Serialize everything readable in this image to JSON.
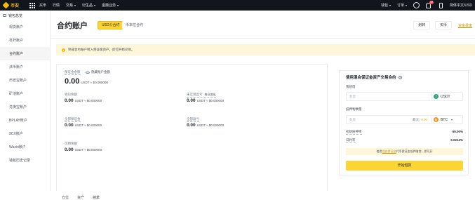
{
  "topbar": {
    "logo_text": "币安",
    "nav": [
      "买币",
      "行情",
      "交易",
      "衍生品",
      "金融业务"
    ],
    "nav_carets": [
      false,
      false,
      true,
      true,
      true
    ],
    "right": {
      "wallet": "钱包",
      "orders": "订单",
      "notifications_count": "18",
      "language": "简体中文/USD"
    }
  },
  "sidebar": {
    "header": "钱包总览",
    "items": [
      "现货账户",
      "杠杆账户",
      "合约账户",
      "法币账户",
      "币安宝账户",
      "矿池账户",
      "兑换宝账户",
      "BPLAY账户",
      "3CX账户",
      "Waziri账户",
      "钱包历史记录"
    ],
    "active_index": 2
  },
  "header": {
    "title": "合约账户",
    "tabs": [
      "USDⓈ合约",
      "币本位合约"
    ],
    "active_tab": 0,
    "buttons": [
      "划转",
      "买币"
    ],
    "link": "资金费率"
  },
  "notice": {
    "icon": "i",
    "text": "完成合约账户转入保证金资产，即可开始交易。"
  },
  "account": {
    "margin_balance_label": "保证金余额",
    "hide_balance_label": "隐藏账户金额",
    "margin_balance": "0.00",
    "margin_balance_fiat": "USDT ≈ $0.000000",
    "wallet_balance_label": "钱包余额",
    "wallet_balance": "0.00",
    "wallet_balance_fiat": "USDT ≈ $0.000000",
    "unrealized_label": "未实现盈亏",
    "unrealized_sort": "每日变化",
    "unrealized": "0.00",
    "unrealized_fiat": "USDT ≈ $0.000000",
    "margin_used_label": "全部保证金",
    "margin_used": "0.00",
    "margin_used_fiat": "USDT ≈ $0.000000",
    "pnl_label": "全部盈亏",
    "pnl": "0.00",
    "pnl_fiat": "USDT ≈ $0.000000",
    "available_label": "可用余额",
    "available": "0.00",
    "available_fiat": "USDT ≈ $0.000000"
  },
  "bottom_tabs": {
    "items": [
      "仓位",
      "资产",
      "挂单"
    ],
    "active": 2
  },
  "borrow_panel": {
    "title": "使用混合保证金资产交易合约",
    "help_icon": "?",
    "borrow_label": "我想借",
    "borrow_placeholder": "数量",
    "borrow_coin": "USDT",
    "borrow_coin_icon": "T",
    "collateral_label": "抵押物数量",
    "collateral_placeholder": "数量",
    "max_label": "最大:",
    "max_value": "0.00",
    "collateral_coin": "BTC",
    "collateral_coin_icon": "₿",
    "ltv_label": "初始质押率",
    "ltv_value": "65.00%",
    "rate_label": "日利率",
    "rate_value": "0.0214%",
    "note_prefix": "使用",
    "note_link": "混合保证金",
    "note_suffix": "代币保证金抵押借贷，即可开",
    "button": "开始借款"
  },
  "colors": {
    "accent": "#fcd535",
    "brand": "#f0b90b",
    "topbar": "#12161c",
    "notice_bg": "#fef6d8"
  }
}
